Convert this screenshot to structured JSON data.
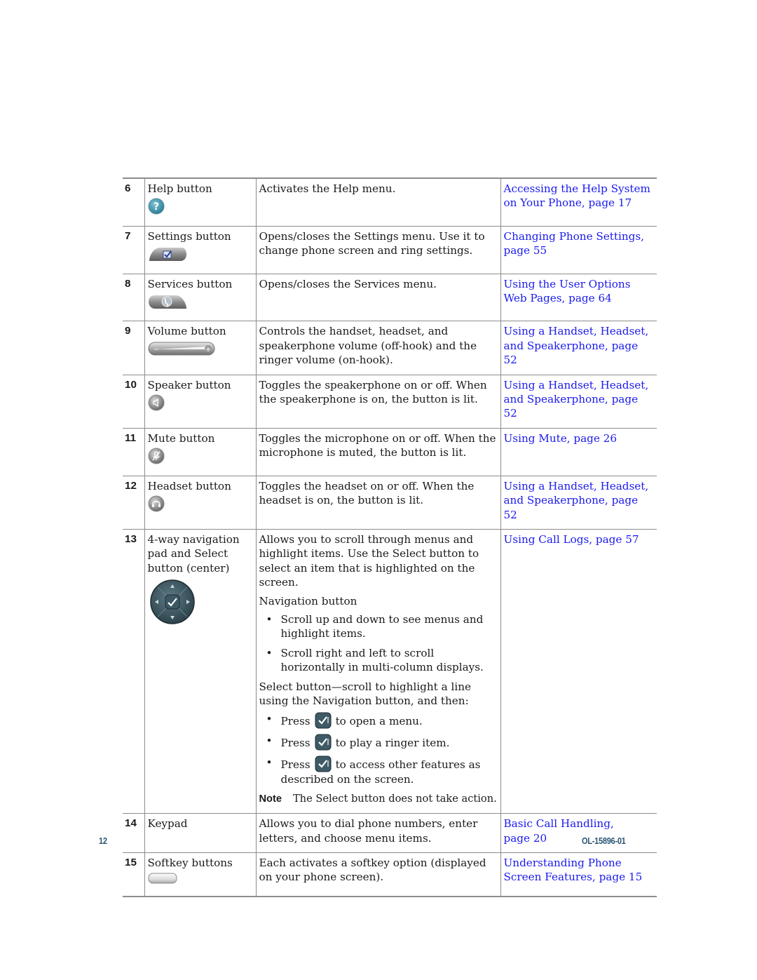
{
  "table": {
    "rows": [
      {
        "num": "6",
        "name": "Help button",
        "icon": "help-question-icon",
        "description": [
          "Activates the Help menu."
        ],
        "reference": [
          "Accessing the Help System",
          "on Your Phone, page 17"
        ]
      },
      {
        "num": "7",
        "name": "Settings button",
        "icon": "settings-checkbox-icon",
        "description": [
          "Opens/closes the Settings menu. Use it to change phone screen and ring settings."
        ],
        "reference": [
          "Changing Phone Settings,",
          "page 55"
        ]
      },
      {
        "num": "8",
        "name": "Services button",
        "icon": "services-globe-icon",
        "description": [
          "Opens/closes the Services menu."
        ],
        "reference": [
          "Using the User Options",
          "Web Pages, page 64"
        ]
      },
      {
        "num": "9",
        "name": "Volume button",
        "icon": "volume-rocker-icon",
        "description": [
          "Controls the handset, headset, and speakerphone volume (off-hook) and the ringer volume (on-hook)."
        ],
        "reference": [
          "Using a Handset, Headset,",
          "and Speakerphone, page 52"
        ]
      },
      {
        "num": "10",
        "name": "Speaker button",
        "icon": "speaker-icon",
        "description": [
          "Toggles the speakerphone on or off. When the speakerphone is on, the button is lit."
        ],
        "reference": [
          "Using a Handset, Headset,",
          "and Speakerphone, page 52"
        ]
      },
      {
        "num": "11",
        "name": "Mute button",
        "icon": "mute-microphone-icon",
        "description": [
          "Toggles the microphone on or off. When the microphone is muted, the button is lit."
        ],
        "reference": [
          "Using Mute, page 26"
        ]
      },
      {
        "num": "12",
        "name": "Headset button",
        "icon": "headset-icon",
        "description": [
          "Toggles the headset on or off. When the headset is on, the button is lit."
        ],
        "reference": [
          "Using a Handset, Headset,",
          "and Speakerphone, page 52"
        ]
      },
      {
        "num": "13",
        "name": "4-way navigation pad and Select button (center)",
        "icon": "navigation-pad-icon",
        "description": [
          "Allows you to scroll through menus and highlight items. Use the Select button to select an item that is highlighted on the screen.",
          "Navigation button"
        ],
        "nav_bullets": [
          "Scroll up and down to see menus and highlight items.",
          "Scroll right and left to scroll horizontally in multi-column displays."
        ],
        "select_intro": "Select button—scroll to highlight a line using the Navigation button, and then:",
        "press_bullets": [
          {
            "before": "Press",
            "after": "to open a menu."
          },
          {
            "before": "Press",
            "after": "to play a ringer item."
          },
          {
            "before": "Press",
            "after": "to access other features as described on the screen."
          }
        ],
        "note_label": "Note",
        "note_text": "The Select button does not take action.",
        "reference": [
          "Using Call Logs, page 57"
        ]
      },
      {
        "num": "14",
        "name": "Keypad",
        "icon": null,
        "description": [
          "Allows you to dial phone numbers, enter letters, and choose menu items."
        ],
        "reference": [
          "Basic Call Handling,",
          "page 20"
        ]
      },
      {
        "num": "15",
        "name": "Softkey buttons",
        "icon": "softkey-button-icon",
        "description": [
          "Each activates a softkey option (displayed on your phone screen)."
        ],
        "reference": [
          "Understanding Phone",
          "Screen Features, page 15"
        ]
      }
    ]
  },
  "footer": {
    "page_number": "12",
    "doc_id": "OL-15896-01"
  },
  "colors": {
    "link": "#1a1aee",
    "footer": "#2b5673",
    "rule": "#8c8c8c"
  }
}
